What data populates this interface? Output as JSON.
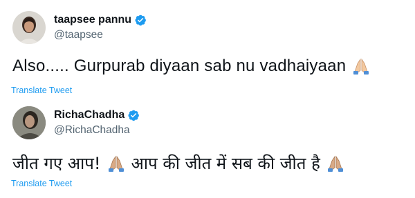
{
  "tweets": [
    {
      "display_name": "taapsee pannu",
      "handle": "@taapsee",
      "text": "Also..... Gurpurab diyaan sab nu vadhaiyaan",
      "emoji_icon": "folded-hands-icon",
      "translate_label": "Translate Tweet"
    },
    {
      "display_name": "RichaChadha",
      "handle": "@RichaChadha",
      "text_part1": "जीत गए आप!",
      "text_part2": "आप की जीत में सब की जीत है",
      "emoji_icon": "folded-hands-icon",
      "translate_label": "Translate Tweet"
    }
  ],
  "colors": {
    "verified": "#1d9bf0",
    "link": "#1d9bf0",
    "secondary_text": "#536471",
    "primary_text": "#0f1419"
  }
}
